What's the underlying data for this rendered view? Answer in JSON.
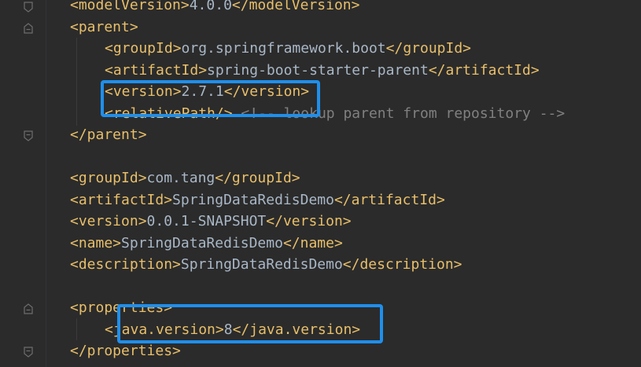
{
  "editor": {
    "lines": [
      {
        "open": "<modelVersion>",
        "text": "4.0.0",
        "close": "</modelVersion>",
        "indent": 1
      },
      {
        "open": "<parent>",
        "text": "",
        "close": "",
        "indent": 1
      },
      {
        "open": "<groupId>",
        "text": "org.springframework.boot",
        "close": "</groupId>",
        "indent": 2
      },
      {
        "open": "<artifactId>",
        "text": "spring-boot-starter-parent",
        "close": "</artifactId>",
        "indent": 2
      },
      {
        "open": "<version>",
        "text": "2.7.1",
        "close": "</version>",
        "indent": 2
      },
      {
        "open": "<relativePath/>",
        "text": "",
        "close": "",
        "comment": "<!-- lookup parent from repository -->",
        "indent": 2
      },
      {
        "open": "</parent>",
        "text": "",
        "close": "",
        "indent": 1
      },
      {
        "open": "<groupId>",
        "text": "com.tang",
        "close": "</groupId>",
        "indent": 1
      },
      {
        "open": "<artifactId>",
        "text": "SpringDataRedisDemo",
        "close": "</artifactId>",
        "indent": 1
      },
      {
        "open": "<version>",
        "text": "0.0.1-SNAPSHOT",
        "close": "</version>",
        "indent": 1
      },
      {
        "open": "<name>",
        "text": "SpringDataRedisDemo",
        "close": "</name>",
        "indent": 1
      },
      {
        "open": "<description>",
        "text": "SpringDataRedisDemo",
        "close": "</description>",
        "indent": 1
      },
      {
        "open": "<properties>",
        "text": "",
        "close": "",
        "indent": 1
      },
      {
        "open": "<java.version>",
        "text": "8",
        "close": "</java.version>",
        "indent": 2
      },
      {
        "open": "</properties>",
        "text": "",
        "close": "",
        "indent": 1
      }
    ]
  },
  "colors": {
    "background": "#2b2b2b",
    "tag": "#e8bf6a",
    "text": "#a9b7c6",
    "comment": "#808080",
    "highlight": "#1f8fec"
  }
}
